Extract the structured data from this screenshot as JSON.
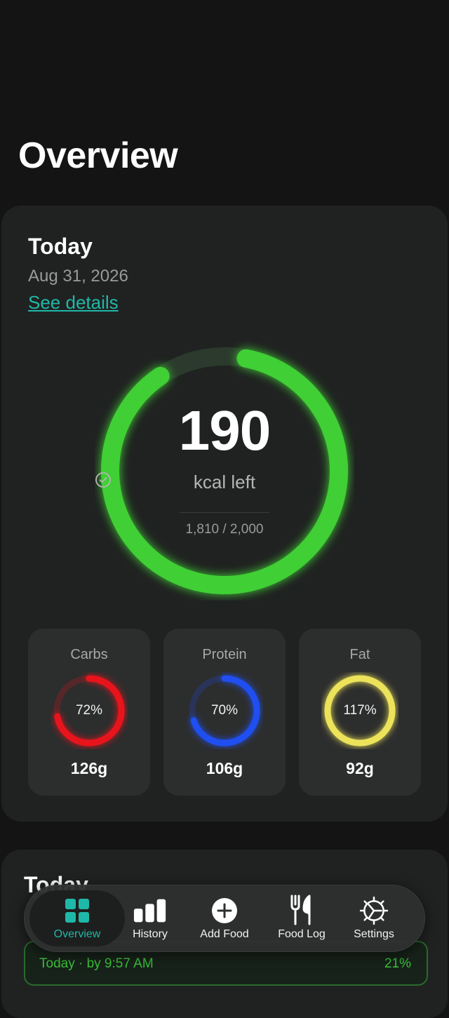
{
  "header": {
    "title": "Overview"
  },
  "today_card": {
    "title": "Today",
    "date": "Aug 31, 2026",
    "details_link": "See details",
    "calories": {
      "remaining": "190",
      "label": "kcal left",
      "consumed_text": "1,810 / 2,000",
      "consumed": 1810,
      "goal": 2000,
      "color": "#3fcf35"
    },
    "macros": [
      {
        "name": "Carbs",
        "percent_label": "72%",
        "percent": 72,
        "grams": "126g",
        "color": "#e8141c"
      },
      {
        "name": "Protein",
        "percent_label": "70%",
        "percent": 70,
        "grams": "106g",
        "color": "#1f4ff0"
      },
      {
        "name": "Fat",
        "percent_label": "117%",
        "percent": 117,
        "grams": "92g",
        "color": "#ece35a"
      }
    ]
  },
  "second_card": {
    "title": "Today",
    "progress_label": "Today · by 9:57 AM",
    "progress_value": "21%"
  },
  "tab_bar": {
    "accent": "#1fb8a8",
    "tabs": [
      {
        "label": "Overview",
        "icon": "grid-icon",
        "active": true
      },
      {
        "label": "History",
        "icon": "bar-chart-icon",
        "active": false
      },
      {
        "label": "Add Food",
        "icon": "plus-circle-icon",
        "active": false
      },
      {
        "label": "Food Log",
        "icon": "fork-knife-icon",
        "active": false
      },
      {
        "label": "Settings",
        "icon": "gear-icon",
        "active": false
      }
    ]
  }
}
